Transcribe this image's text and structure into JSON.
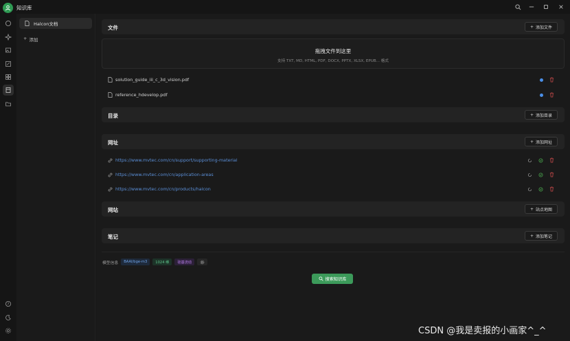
{
  "app": {
    "title": "知识库",
    "accent": "#3c9a5a"
  },
  "knowledge_bases": {
    "items": [
      {
        "label": "Halcon文档"
      }
    ],
    "add_label": "添加"
  },
  "sections": {
    "files": {
      "title": "文件",
      "button": "添加文件",
      "drop_title": "拖拽文件到这里",
      "drop_sub": "支持 TXT, MD, HTML, PDF, DOCX, PPTX, XLSX, EPUB... 格式",
      "items": [
        {
          "name": "solution_guide_iii_c_3d_vision.pdf"
        },
        {
          "name": "reference_hdevelop.pdf"
        }
      ]
    },
    "directory": {
      "title": "目录",
      "button": "添加目录"
    },
    "urls": {
      "title": "网址",
      "button": "添加网址",
      "items": [
        {
          "url": "https://www.mvtec.com/cn/support/supporting-material"
        },
        {
          "url": "https://www.mvtec.com/cn/application-areas"
        },
        {
          "url": "https://www.mvtec.com/cn/products/halcon"
        }
      ]
    },
    "sites": {
      "title": "网站",
      "button": "站点地图"
    },
    "notes": {
      "title": "笔记",
      "button": "添加笔记"
    }
  },
  "model": {
    "label": "模型信息",
    "tags": [
      {
        "text": "BAAI/bge-m3",
        "color": "#3c6fb0"
      },
      {
        "text": "1024 维",
        "color": "#3a9a6a"
      },
      {
        "text": "硅基流动",
        "color": "#8a4fc8"
      }
    ]
  },
  "search_button": "搜索知识库",
  "watermark": "CSDN @我是卖报的小画家^_^"
}
